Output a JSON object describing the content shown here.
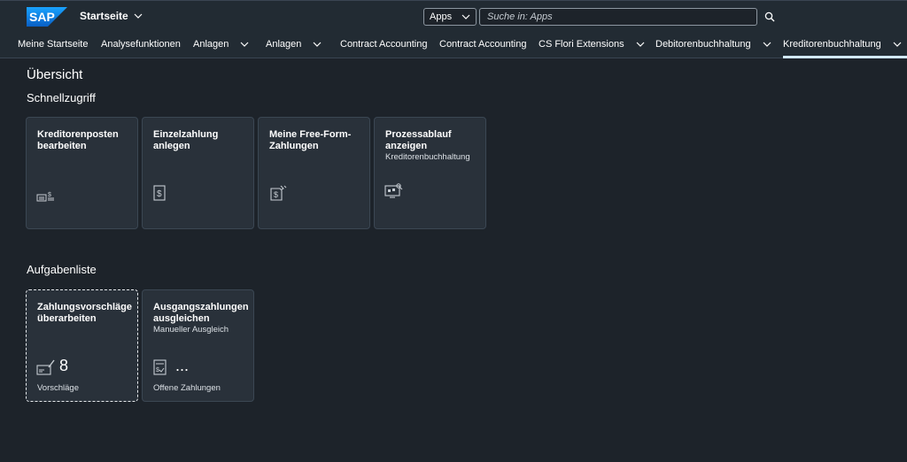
{
  "shell": {
    "logo_text": "SAP",
    "home_title": "Startseite",
    "search_scope": "Apps",
    "search_placeholder": "Suche in: Apps"
  },
  "tabs": [
    {
      "label": "Meine Startseite"
    },
    {
      "label": "Analysefunktionen"
    },
    {
      "label": "Anlagen"
    },
    {
      "label": "Anlagen"
    },
    {
      "label": "Contract Accounting"
    },
    {
      "label": "Contract Accounting"
    },
    {
      "label": "CS Flori Extensions"
    },
    {
      "label": "Debitorenbuchhaltung"
    },
    {
      "label": "Kreditorenbuchhaltung"
    }
  ],
  "main": {
    "page_title": "Übersicht",
    "quick_access": {
      "title": "Schnellzugriff",
      "tiles": [
        {
          "title": "Kreditorenposten bearbeiten",
          "subtitle": "",
          "icon": "account-payable-icon"
        },
        {
          "title": "Einzelzahlung anlegen",
          "subtitle": "",
          "icon": "payment-document-icon"
        },
        {
          "title": "Meine Free-Form-Zahlungen",
          "subtitle": "",
          "icon": "payment-edit-icon"
        },
        {
          "title": "Prozessablauf anzeigen",
          "subtitle": "Kreditorenbuchhaltung",
          "icon": "process-monitor-icon"
        }
      ]
    },
    "task_list": {
      "title": "Aufgabenliste",
      "tiles": [
        {
          "title": "Zahlungsvorschläge überarbeiten",
          "subtitle": "",
          "kpi": "8",
          "footer": "Vorschläge",
          "icon": "payment-proposal-icon"
        },
        {
          "title": "Ausgangszahlungen ausgleichen",
          "subtitle": "Manueller Ausgleich",
          "kpi": "...",
          "footer": "Offene Zahlungen",
          "icon": "clearing-document-icon"
        }
      ]
    }
  },
  "colors": {
    "background": "#1d232a",
    "shell": "#222b33",
    "tile": "#29313a",
    "brand_logo": "#0a6ed1",
    "active_tab_indicator": "#d1e8ff"
  }
}
